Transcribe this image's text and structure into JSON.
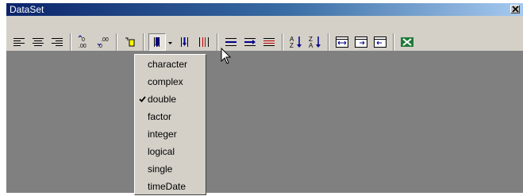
{
  "window": {
    "title": "DataSet"
  },
  "titlebar": {
    "close_icon": "close-x-icon"
  },
  "toolbar": {
    "buttons": [
      {
        "name": "align-left-icon"
      },
      {
        "name": "align-center-icon"
      },
      {
        "name": "align-right-icon"
      },
      {
        "name": "increase-decimal-icon"
      },
      {
        "name": "decrease-decimal-icon"
      },
      {
        "name": "paint-format-icon"
      },
      {
        "name": "insert-column-icon"
      },
      {
        "name": "column-type-dropdown-arrow"
      },
      {
        "name": "insert-rows-icon"
      },
      {
        "name": "delete-columns-icon"
      },
      {
        "name": "indent-icon"
      },
      {
        "name": "outdent-icon"
      },
      {
        "name": "remove-rows-icon"
      },
      {
        "name": "sort-ascending-icon"
      },
      {
        "name": "sort-descending-icon"
      },
      {
        "name": "fit-width-icon"
      },
      {
        "name": "fit-page-icon"
      },
      {
        "name": "shrink-icon"
      },
      {
        "name": "excel-export-icon"
      }
    ],
    "decimal_increase_text": ".00",
    "decimal_decrease_text": ".00"
  },
  "menu": {
    "selected": "double",
    "items": [
      {
        "label": "character"
      },
      {
        "label": "complex"
      },
      {
        "label": "double",
        "checked": true
      },
      {
        "label": "factor"
      },
      {
        "label": "integer"
      },
      {
        "label": "logical"
      },
      {
        "label": "single"
      },
      {
        "label": "timeDate"
      }
    ]
  }
}
